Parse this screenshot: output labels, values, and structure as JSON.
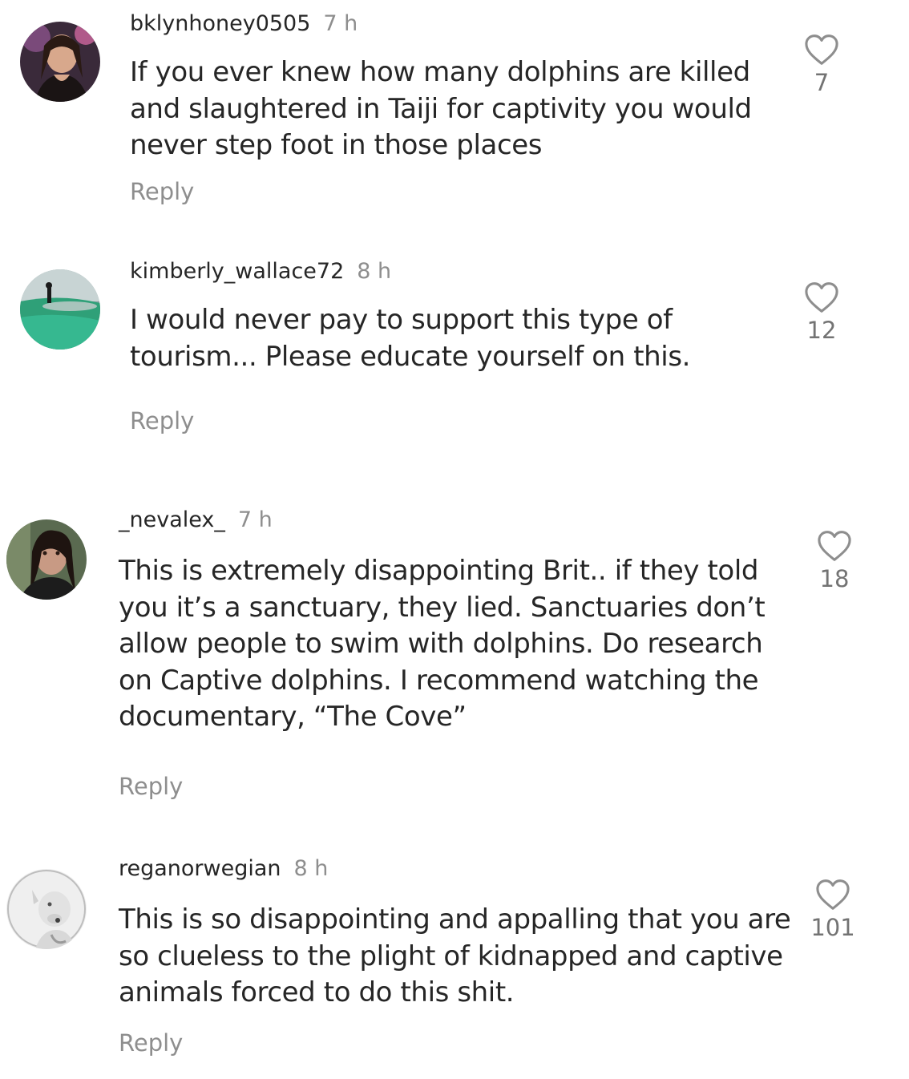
{
  "comments": [
    {
      "username": "bklynhoney0505",
      "time": "7 h",
      "text": "If you ever knew how many dolphins are killed and slaughtered in Taiji for captivity you would never step foot in those places",
      "likes": "7",
      "reply": "Reply"
    },
    {
      "username": "kimberly_wallace72",
      "time": "8 h",
      "text": "I would never pay to support this type of tourism... Please educate yourself on this.",
      "likes": "12",
      "reply": "Reply"
    },
    {
      "username": "_nevalex_",
      "time": "7 h",
      "text": "This is extremely disappointing Brit.. if they told you it’s a sanctuary, they lied. Sanctuaries don’t allow people to swim with dolphins. Do research on Captive dolphins. I recommend watching the documentary, “The Cove”",
      "likes": "18",
      "reply": "Reply"
    },
    {
      "username": "reganorwegian",
      "time": "8 h",
      "text": "This is so disappointing and appalling that you are so clueless to the plight of kidnapped and captive animals forced to do this shit.",
      "likes": "101",
      "reply": "Reply"
    }
  ],
  "colors": {
    "text": "#262626",
    "secondary": "#8e8e8e",
    "background": "#ffffff"
  },
  "icons": {
    "like": "heart-outline-icon"
  }
}
